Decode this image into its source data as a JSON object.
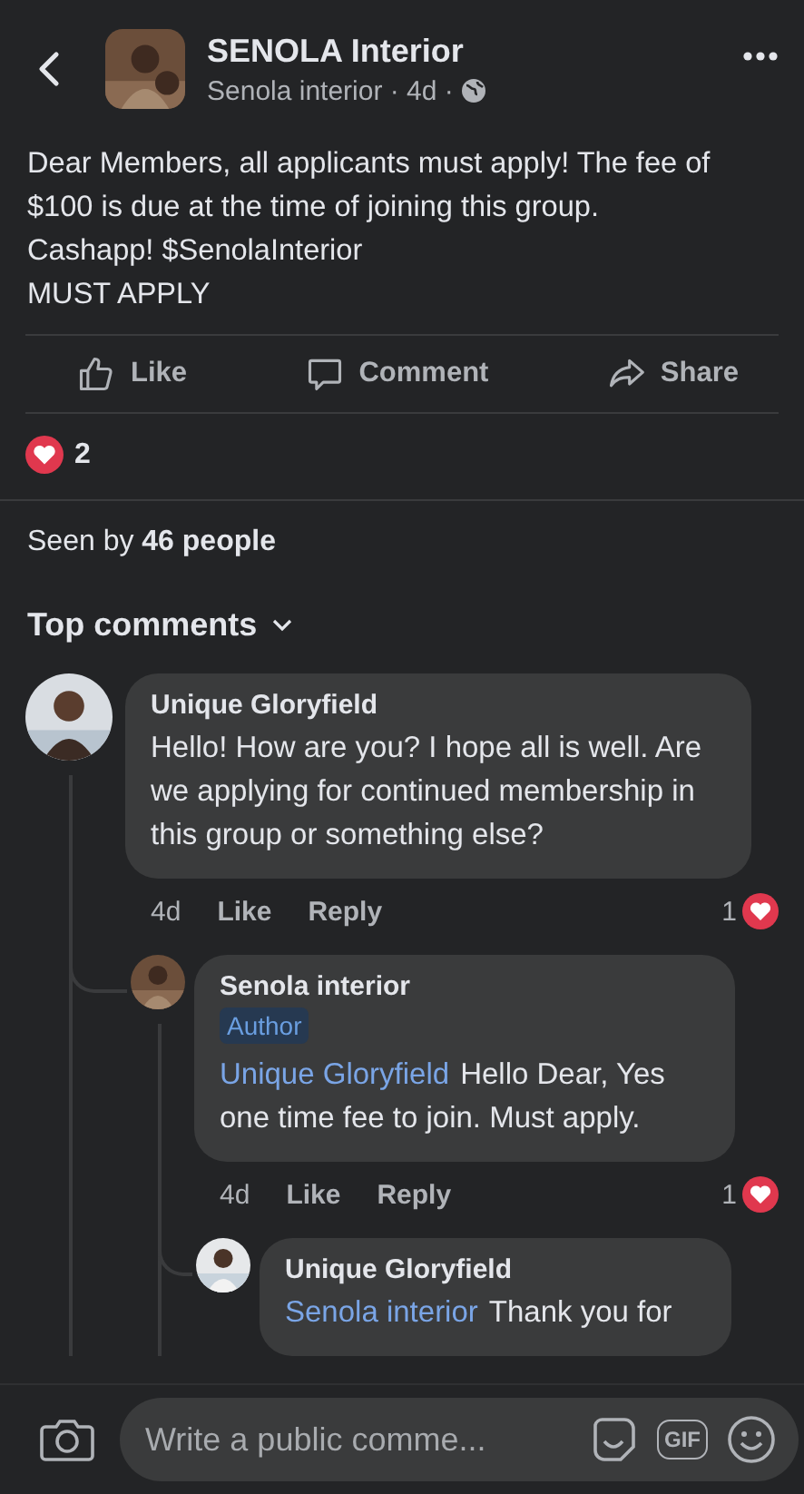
{
  "header": {
    "title": "SENOLA Interior",
    "subtitle": "Senola interior · 4d ·"
  },
  "post": {
    "paragraphs": [
      "Dear Members, all applicants must apply! The fee of $100 is due at the time of joining this group.",
      "Cashapp! $SenolaInterior",
      "MUST APPLY"
    ]
  },
  "actions": [
    {
      "kind": "like",
      "label": "Like"
    },
    {
      "kind": "comment",
      "label": "Comment"
    },
    {
      "kind": "share",
      "label": "Share"
    }
  ],
  "reactions": {
    "count": "2"
  },
  "seen": "Seen by **46 people**",
  "sort": {
    "label": "Top comments"
  },
  "comments": [
    {
      "author": "Unique Gloryfield",
      "text": "Hello! How are you? I hope all is well. Are we applying for continued membership in this group or something else?",
      "meta": {
        "time": "4d",
        "like": "Like",
        "reply": "Reply",
        "count": "1"
      },
      "children": [
        {
          "author": "Senola interior",
          "badge": "Author",
          "mention": "Unique Gloryfield",
          "text": "Hello Dear, Yes one time fee to join. Must apply.",
          "meta": {
            "time": "4d",
            "like": "Like",
            "reply": "Reply",
            "count": "1"
          },
          "children": [
            {
              "author": "Unique Gloryfield",
              "mention": "Senola interior",
              "text": "Thank you for"
            }
          ]
        }
      ]
    }
  ],
  "composer": {
    "placeholder": "Write a public comme...",
    "gif": "GIF"
  }
}
